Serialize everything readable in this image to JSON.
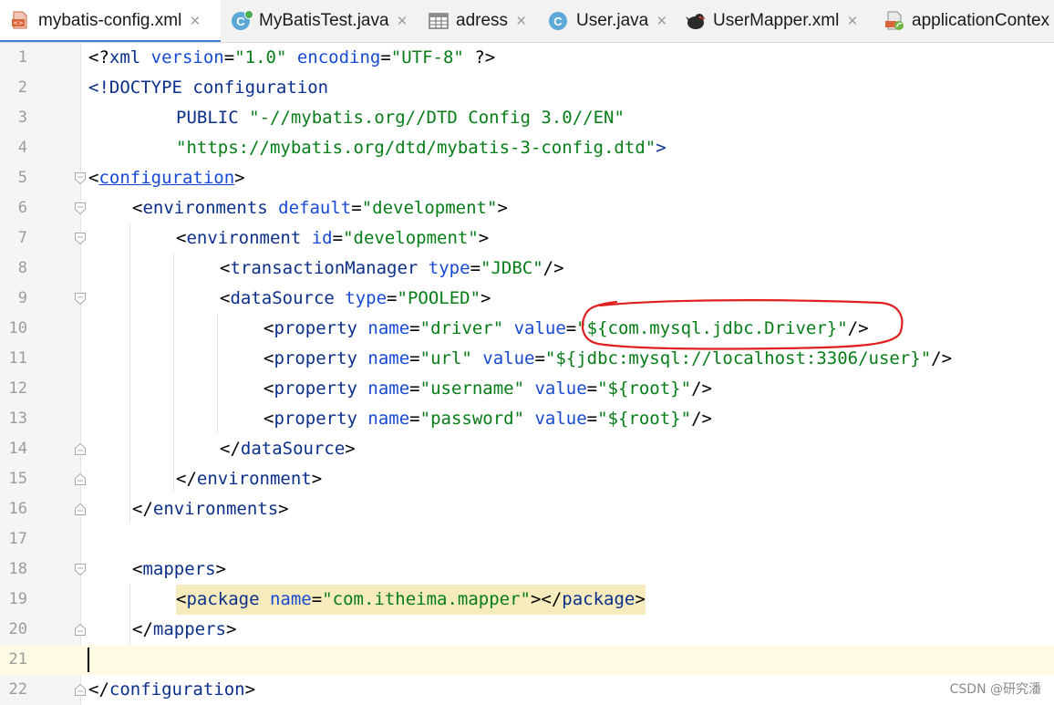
{
  "tabs": [
    {
      "label": "mybatis-config.xml",
      "icon": "xml-file-icon",
      "active": true
    },
    {
      "label": "MyBatisTest.java",
      "icon": "java-class-icon",
      "active": false
    },
    {
      "label": "adress",
      "icon": "table-icon",
      "active": false
    },
    {
      "label": "User.java",
      "icon": "java-class-icon",
      "active": false
    },
    {
      "label": "UserMapper.xml",
      "icon": "mybatis-bird-icon",
      "active": false
    },
    {
      "label": "applicationContex",
      "icon": "spring-xml-icon",
      "active": false
    }
  ],
  "close_glyph": "×",
  "lines": [
    {
      "num": "1"
    },
    {
      "num": "2"
    },
    {
      "num": "3"
    },
    {
      "num": "4"
    },
    {
      "num": "5"
    },
    {
      "num": "6"
    },
    {
      "num": "7"
    },
    {
      "num": "8"
    },
    {
      "num": "9"
    },
    {
      "num": "10"
    },
    {
      "num": "11"
    },
    {
      "num": "12"
    },
    {
      "num": "13"
    },
    {
      "num": "14"
    },
    {
      "num": "15"
    },
    {
      "num": "16"
    },
    {
      "num": "17"
    },
    {
      "num": "18"
    },
    {
      "num": "19"
    },
    {
      "num": "20"
    },
    {
      "num": "21"
    },
    {
      "num": "22"
    }
  ],
  "code": {
    "l1": {
      "open": "<?",
      "name": "xml",
      "a1": " version",
      "eq1": "=",
      "v1": "\"1.0\"",
      "a2": " encoding",
      "eq2": "=",
      "v2": "\"UTF-8\"",
      "close": " ?>"
    },
    "l2": {
      "text": "<!DOCTYPE configuration"
    },
    "l3": {
      "kw": "PUBLIC",
      "str": " \"-//mybatis.org//DTD Config 3.0//EN\""
    },
    "l4": {
      "str": "\"https://mybatis.org/dtd/mybatis-3-config.dtd\"",
      "close": ">"
    },
    "l5": {
      "lt": "<",
      "name": "configuration",
      "gt": ">"
    },
    "l6": {
      "lt": "<",
      "name": "environments",
      "attr": " default",
      "eq": "=",
      "val": "\"development\"",
      "gt": ">"
    },
    "l7": {
      "lt": "<",
      "name": "environment",
      "attr": " id",
      "eq": "=",
      "val": "\"development\"",
      "gt": ">"
    },
    "l8": {
      "lt": "<",
      "name": "transactionManager",
      "attr": " type",
      "eq": "=",
      "val": "\"JDBC\"",
      "gt": "/>"
    },
    "l9": {
      "lt": "<",
      "name": "dataSource",
      "attr": " type",
      "eq": "=",
      "val": "\"POOLED\"",
      "gt": ">"
    },
    "l10": {
      "lt": "<",
      "name": "property",
      "a1": " name",
      "eq1": "=",
      "v1": "\"driver\"",
      "a2": " value",
      "eq2": "=",
      "v2": "\"${com.mysql.jdbc.Driver}\"",
      "gt": "/>"
    },
    "l11": {
      "lt": "<",
      "name": "property",
      "a1": " name",
      "eq1": "=",
      "v1": "\"url\"",
      "a2": " value",
      "eq2": "=",
      "v2": "\"${jdbc:mysql://localhost:3306/user}\"",
      "gt": "/>"
    },
    "l12": {
      "lt": "<",
      "name": "property",
      "a1": " name",
      "eq1": "=",
      "v1": "\"username\"",
      "a2": " value",
      "eq2": "=",
      "v2": "\"${root}\"",
      "gt": "/>"
    },
    "l13": {
      "lt": "<",
      "name": "property",
      "a1": " name",
      "eq1": "=",
      "v1": "\"password\"",
      "a2": " value",
      "eq2": "=",
      "v2": "\"${root}\"",
      "gt": "/>"
    },
    "l14": {
      "lt": "</",
      "name": "dataSource",
      "gt": ">"
    },
    "l15": {
      "lt": "</",
      "name": "environment",
      "gt": ">"
    },
    "l16": {
      "lt": "</",
      "name": "environments",
      "gt": ">"
    },
    "l18": {
      "lt": "<",
      "name": "mappers",
      "gt": ">"
    },
    "l19": {
      "lt": "<",
      "name": "package",
      "attr": " name",
      "eq": "=",
      "val": "\"com.itheima.mapper\"",
      "gt": "></",
      "name2": "package",
      "gt2": ">"
    },
    "l20": {
      "lt": "</",
      "name": "mappers",
      "gt": ">"
    },
    "l22": {
      "lt": "</",
      "name": "configuration",
      "gt": ">"
    }
  },
  "watermark": "CSDN @研究潘",
  "colors": {
    "tag": "#0b2f8a",
    "attr": "#174ad4",
    "string": "#067d17",
    "active_tab_underline": "#3d7fd6",
    "annotation": "#e02020"
  }
}
